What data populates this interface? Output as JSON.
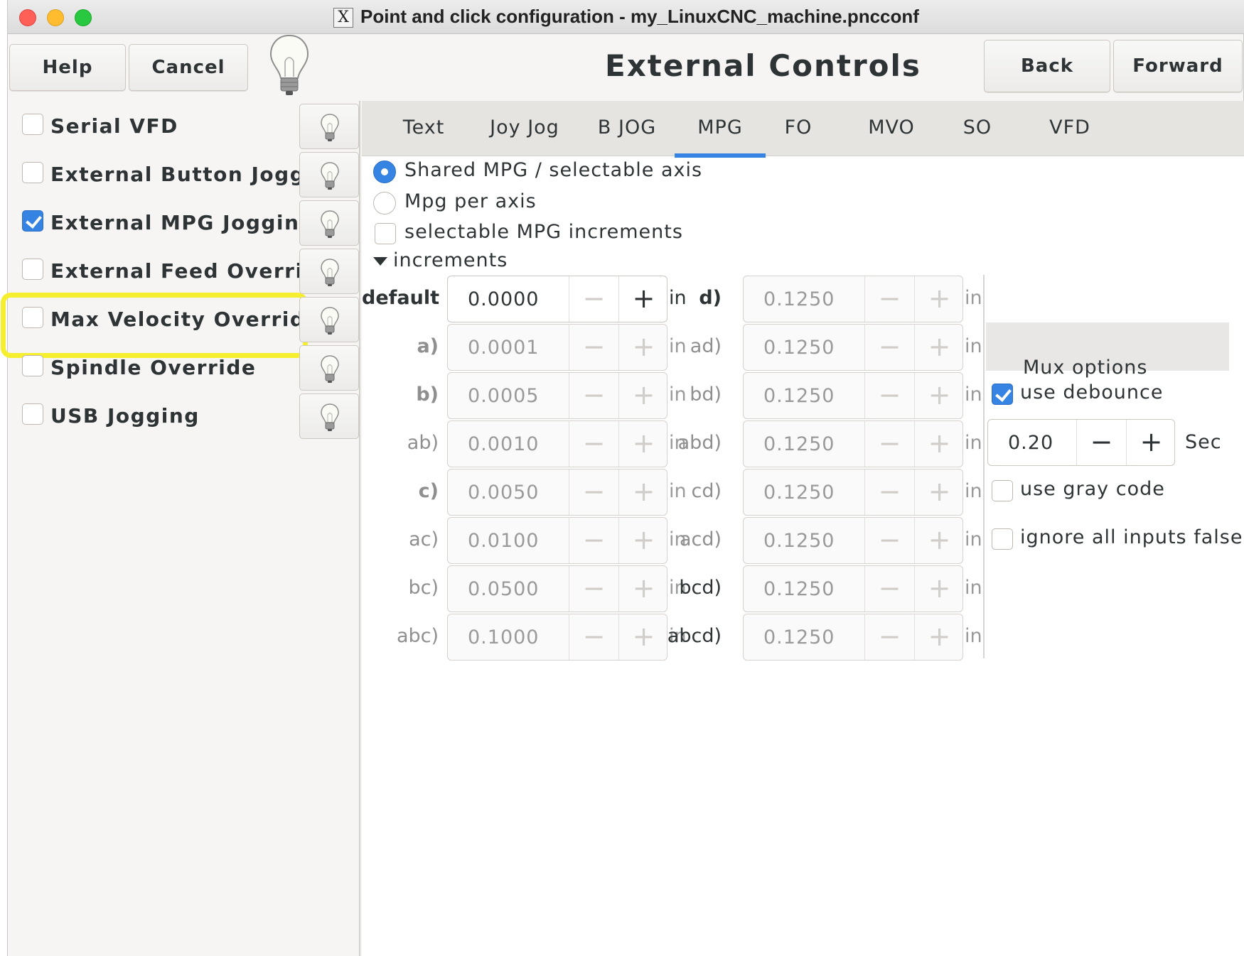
{
  "window": {
    "title": "Point and click configuration - my_LinuxCNC_machine.pncconf",
    "x_icon_glyph": "X"
  },
  "header": {
    "help_label": "Help",
    "cancel_label": "Cancel",
    "page_title": "External Controls",
    "back_label": "Back",
    "forward_label": "Forward"
  },
  "sidebar": {
    "items": [
      {
        "label": "Serial VFD",
        "checked": false
      },
      {
        "label": "External Button Jogging",
        "checked": false
      },
      {
        "label": "External MPG Jogging",
        "checked": true
      },
      {
        "label": "External Feed Override",
        "checked": false
      },
      {
        "label": "Max Velocity Override",
        "checked": false
      },
      {
        "label": "Spindle Override",
        "checked": false
      },
      {
        "label": "USB Jogging",
        "checked": false
      }
    ],
    "highlight_color": "#f6ef2f"
  },
  "tabs": [
    {
      "label": "Text"
    },
    {
      "label": "Joy Jog"
    },
    {
      "label": "B JOG"
    },
    {
      "label": "MPG",
      "active": true
    },
    {
      "label": "FO"
    },
    {
      "label": "MVO"
    },
    {
      "label": "SO"
    },
    {
      "label": "VFD"
    }
  ],
  "mpg": {
    "mode_shared_label": "Shared MPG / selectable axis",
    "mode_shared_selected": true,
    "mode_per_axis_label": "Mpg per axis",
    "selectable_increments_label": "selectable MPG increments",
    "selectable_increments_checked": false,
    "increments_expander_label": "increments",
    "unit": "in",
    "left_rows": [
      {
        "label": "default",
        "value": "0.0000"
      },
      {
        "label": "a)",
        "value": "0.0001"
      },
      {
        "label": "b)",
        "value": "0.0005"
      },
      {
        "label": "ab)",
        "value": "0.0010"
      },
      {
        "label": "c)",
        "value": "0.0050"
      },
      {
        "label": "ac)",
        "value": "0.0100"
      },
      {
        "label": "bc)",
        "value": "0.0500"
      },
      {
        "label": "abc)",
        "value": "0.1000"
      }
    ],
    "right_rows": [
      {
        "label": "d)",
        "value": "0.1250"
      },
      {
        "label": "ad)",
        "value": "0.1250"
      },
      {
        "label": "bd)",
        "value": "0.1250"
      },
      {
        "label": "abd)",
        "value": "0.1250"
      },
      {
        "label": "cd)",
        "value": "0.1250"
      },
      {
        "label": "acd)",
        "value": "0.1250"
      },
      {
        "label": "bcd)",
        "value": "0.1250"
      },
      {
        "label": "abcd)",
        "value": "0.1250"
      }
    ],
    "mux": {
      "title": "Mux options",
      "use_debounce_label": "use debounce",
      "use_debounce_checked": true,
      "debounce_value": "0.20",
      "debounce_unit": "Sec",
      "gray_code_label": "use gray code",
      "gray_code_checked": false,
      "ignore_false_label": "ignore all inputs false",
      "ignore_false_checked": false
    }
  },
  "glyphs": {
    "minus": "−",
    "plus": "+"
  },
  "colors": {
    "accent": "#3584e4"
  }
}
